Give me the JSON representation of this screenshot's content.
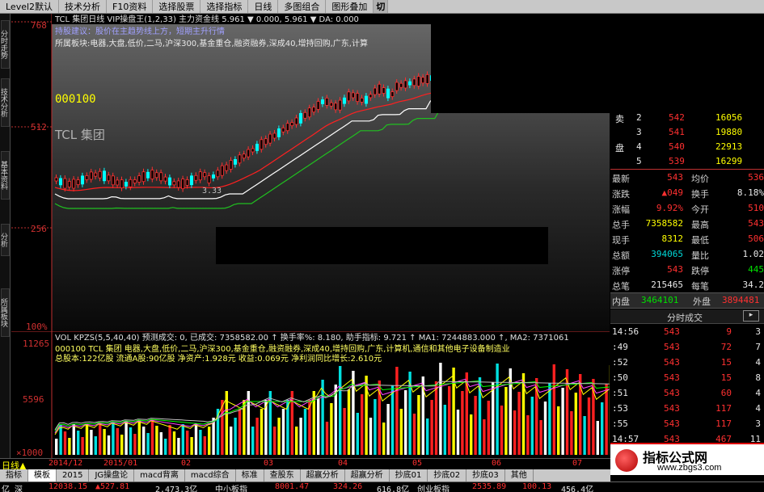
{
  "menu": {
    "items": [
      "Level2默认",
      "技术分析",
      "F10资料",
      "选择股票",
      "选择指标",
      "日线",
      "多图组合",
      "图形叠加"
    ],
    "toggle": "切"
  },
  "left_tabs": [
    "分时走势",
    "技术分析",
    "基本资料",
    "分析",
    "所属板块"
  ],
  "chart": {
    "header": "TCL 集团日线  VIP操盘王(1,2,33)  主力资金线  5.961 ▼ 0.000, 5.961 ▼ DA: 0.000",
    "tips": "持股建议：股价在主趋势线上方，短期主升行情",
    "sector": "所属板块:电器,大盘,低价,二马,沪深300,基金重仓,融资融券,深成40,增持回购,广东,计算",
    "code": "000100",
    "name": "TCL 集团",
    "y_labels": [
      "768",
      "512",
      "256",
      "100%"
    ],
    "low_marker": "3.33",
    "colors": {
      "up": "#ff2e2e",
      "down": "#00ffff",
      "ma_main": "#ff2020",
      "band_upper": "#ffffff",
      "band_lower": "#20c020",
      "tip": "#a0a0ff"
    }
  },
  "volume": {
    "header": "VOL KPZS(5,5,40,40)  预测成交: 0, 已成交: 7358582.00 ↑ 换手率%: 8.180, 助手指标: 9.721 ↑ MA1: 7244883.000 ↑, MA2: 7371061",
    "info1": "000100 TCL 集团 电器,大盘,低价,二马,沪深300,基金重仓,融资融券,深成40,增持回购,广东,计算机,通信和其他电子设备制造业",
    "info2": "总股本:122亿股  流通A股:90亿股    净资产:1.928元   收益:0.069元    净利润同比增长:2.610元",
    "y_labels": [
      "11265",
      "5596",
      "×1000"
    ]
  },
  "orderbook": [
    {
      "label": "卖",
      "idx": "2",
      "price": "542",
      "vol": "16056"
    },
    {
      "label": "",
      "idx": "3",
      "price": "541",
      "vol": "19880"
    },
    {
      "label": "盘",
      "idx": "4",
      "price": "540",
      "vol": "22913"
    },
    {
      "label": "",
      "idx": "5",
      "price": "539",
      "vol": "16299"
    }
  ],
  "stats": [
    {
      "l1": "最新",
      "v1": "543",
      "l2": "均价",
      "v2": "536"
    },
    {
      "l1": "涨跌",
      "v1": "▲049",
      "l2": "换手",
      "v2": "8.18%"
    },
    {
      "l1": "涨幅",
      "v1": "9.92%",
      "l2": "今开",
      "v2": "510"
    },
    {
      "l1": "总手",
      "v1": "7358582",
      "l2": "最高",
      "v2": "543"
    },
    {
      "l1": "现手",
      "v1": "8312",
      "l2": "最低",
      "v2": "506"
    },
    {
      "l1": "总额",
      "v1": "394065",
      "l2": "量比",
      "v2": "1.02"
    },
    {
      "l1": "涨停",
      "v1": "543",
      "l2": "跌停",
      "v2": "445"
    },
    {
      "l1": "总笔",
      "v1": "215465",
      "l2": "每笔",
      "v2": "34.2"
    }
  ],
  "neipan": {
    "label": "内盘",
    "value": "3464101",
    "label2": "外盘",
    "value2": "3894481"
  },
  "ticks_header": "分时成交",
  "ticks": [
    {
      "time": "14:56",
      "price": "543",
      "vol": "9",
      "n": "3"
    },
    {
      "time": ":49",
      "price": "543",
      "vol": "72",
      "n": "7"
    },
    {
      "time": ":52",
      "price": "543",
      "vol": "15",
      "n": "4"
    },
    {
      "time": ":50",
      "price": "543",
      "vol": "15",
      "n": "8"
    },
    {
      "time": ":51",
      "price": "543",
      "vol": "60",
      "n": "4"
    },
    {
      "time": ":53",
      "price": "543",
      "vol": "117",
      "n": "4"
    },
    {
      "time": ":55",
      "price": "543",
      "vol": "117",
      "n": "3"
    },
    {
      "time": "14:57",
      "price": "543",
      "vol": "467",
      "n": "11"
    }
  ],
  "period_bar": {
    "label": "日线▲",
    "dates": [
      "2014/12",
      "2015/01",
      "02",
      "03",
      "04",
      "05",
      "06",
      "07"
    ]
  },
  "tabs": [
    "指标",
    "模板",
    "2015",
    "JG操盘论",
    "macd背离",
    "macd综合",
    "标准",
    "查股东",
    "超赢分析",
    "超赢分析",
    "抄底01",
    "抄底02",
    "抄底03",
    "其他"
  ],
  "indexbar": {
    "items": [
      "亿 深",
      "12038.15",
      "▲527.81",
      "2.473.3亿",
      "中小板指",
      "8001.47",
      "324.26",
      "616.8亿",
      "创业板指",
      "2535.89",
      "100.13",
      "456.4亿"
    ]
  },
  "watermark": {
    "title": "指标公式网",
    "url": "www.zbgs3.com"
  }
}
